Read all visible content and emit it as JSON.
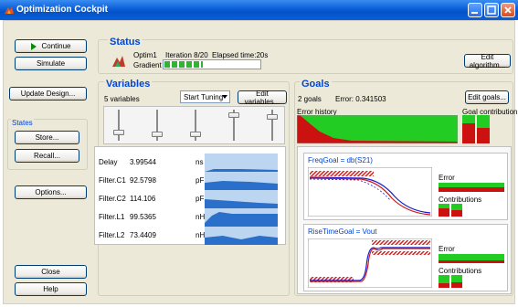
{
  "window": {
    "title": "Optimization Cockpit",
    "icon": "matlab-icon",
    "controls": [
      "minimize-icon",
      "maximize-icon",
      "close-icon"
    ]
  },
  "left_panel": {
    "continue_label": "Continue",
    "simulate_label": "Simulate",
    "update_design_label": "Update Design...",
    "states_label": "States",
    "store_label": "Store...",
    "recall_label": "Recall...",
    "options_label": "Options...",
    "close_label": "Close",
    "help_label": "Help"
  },
  "status": {
    "heading": "Status",
    "optim_name": "Optim1",
    "iteration": "Iteration 8/20",
    "elapsed": "Elapsed time:20s",
    "method": "Gradient",
    "progress_fraction": 0.4,
    "edit_algorithm_label": "Edit algorithm..."
  },
  "variables": {
    "heading": "Variables",
    "count_label": "5 variables",
    "tuning_select": "Start Tuning",
    "edit_label": "Edit variables...",
    "slider_levels": [
      0.65,
      0.7,
      0.7,
      0.1,
      0.15
    ],
    "rows": [
      {
        "name": "Delay",
        "value": "3.99544",
        "unit": "ns"
      },
      {
        "name": "Filter.C1",
        "value": "92.5798",
        "unit": "pF"
      },
      {
        "name": "Filter.C2",
        "value": "114.106",
        "unit": "pF"
      },
      {
        "name": "Filter.L1",
        "value": "99.5365",
        "unit": "nH"
      },
      {
        "name": "Filter.L2",
        "value": "73.4409",
        "unit": "nH"
      }
    ]
  },
  "goals": {
    "heading": "Goals",
    "count_label": "2 goals",
    "error_label": "Error: 0.341503",
    "edit_label": "Edit goals...",
    "error_history_label": "Error history",
    "goal_contributions_label": "Goal contributions",
    "items": [
      {
        "title": "FreqGoal = db(S21)",
        "error_label": "Error",
        "contributions_label": "Contributions"
      },
      {
        "title": "RiseTimeGoal = Vout",
        "error_label": "Error",
        "contributions_label": "Contributions"
      }
    ]
  },
  "colors": {
    "heading_blue": "#0046d5",
    "progress_green": "#2fb52f",
    "error_green": "#22cc22",
    "error_red": "#cc1111",
    "sparkline_blue": "#2a6fc9"
  }
}
